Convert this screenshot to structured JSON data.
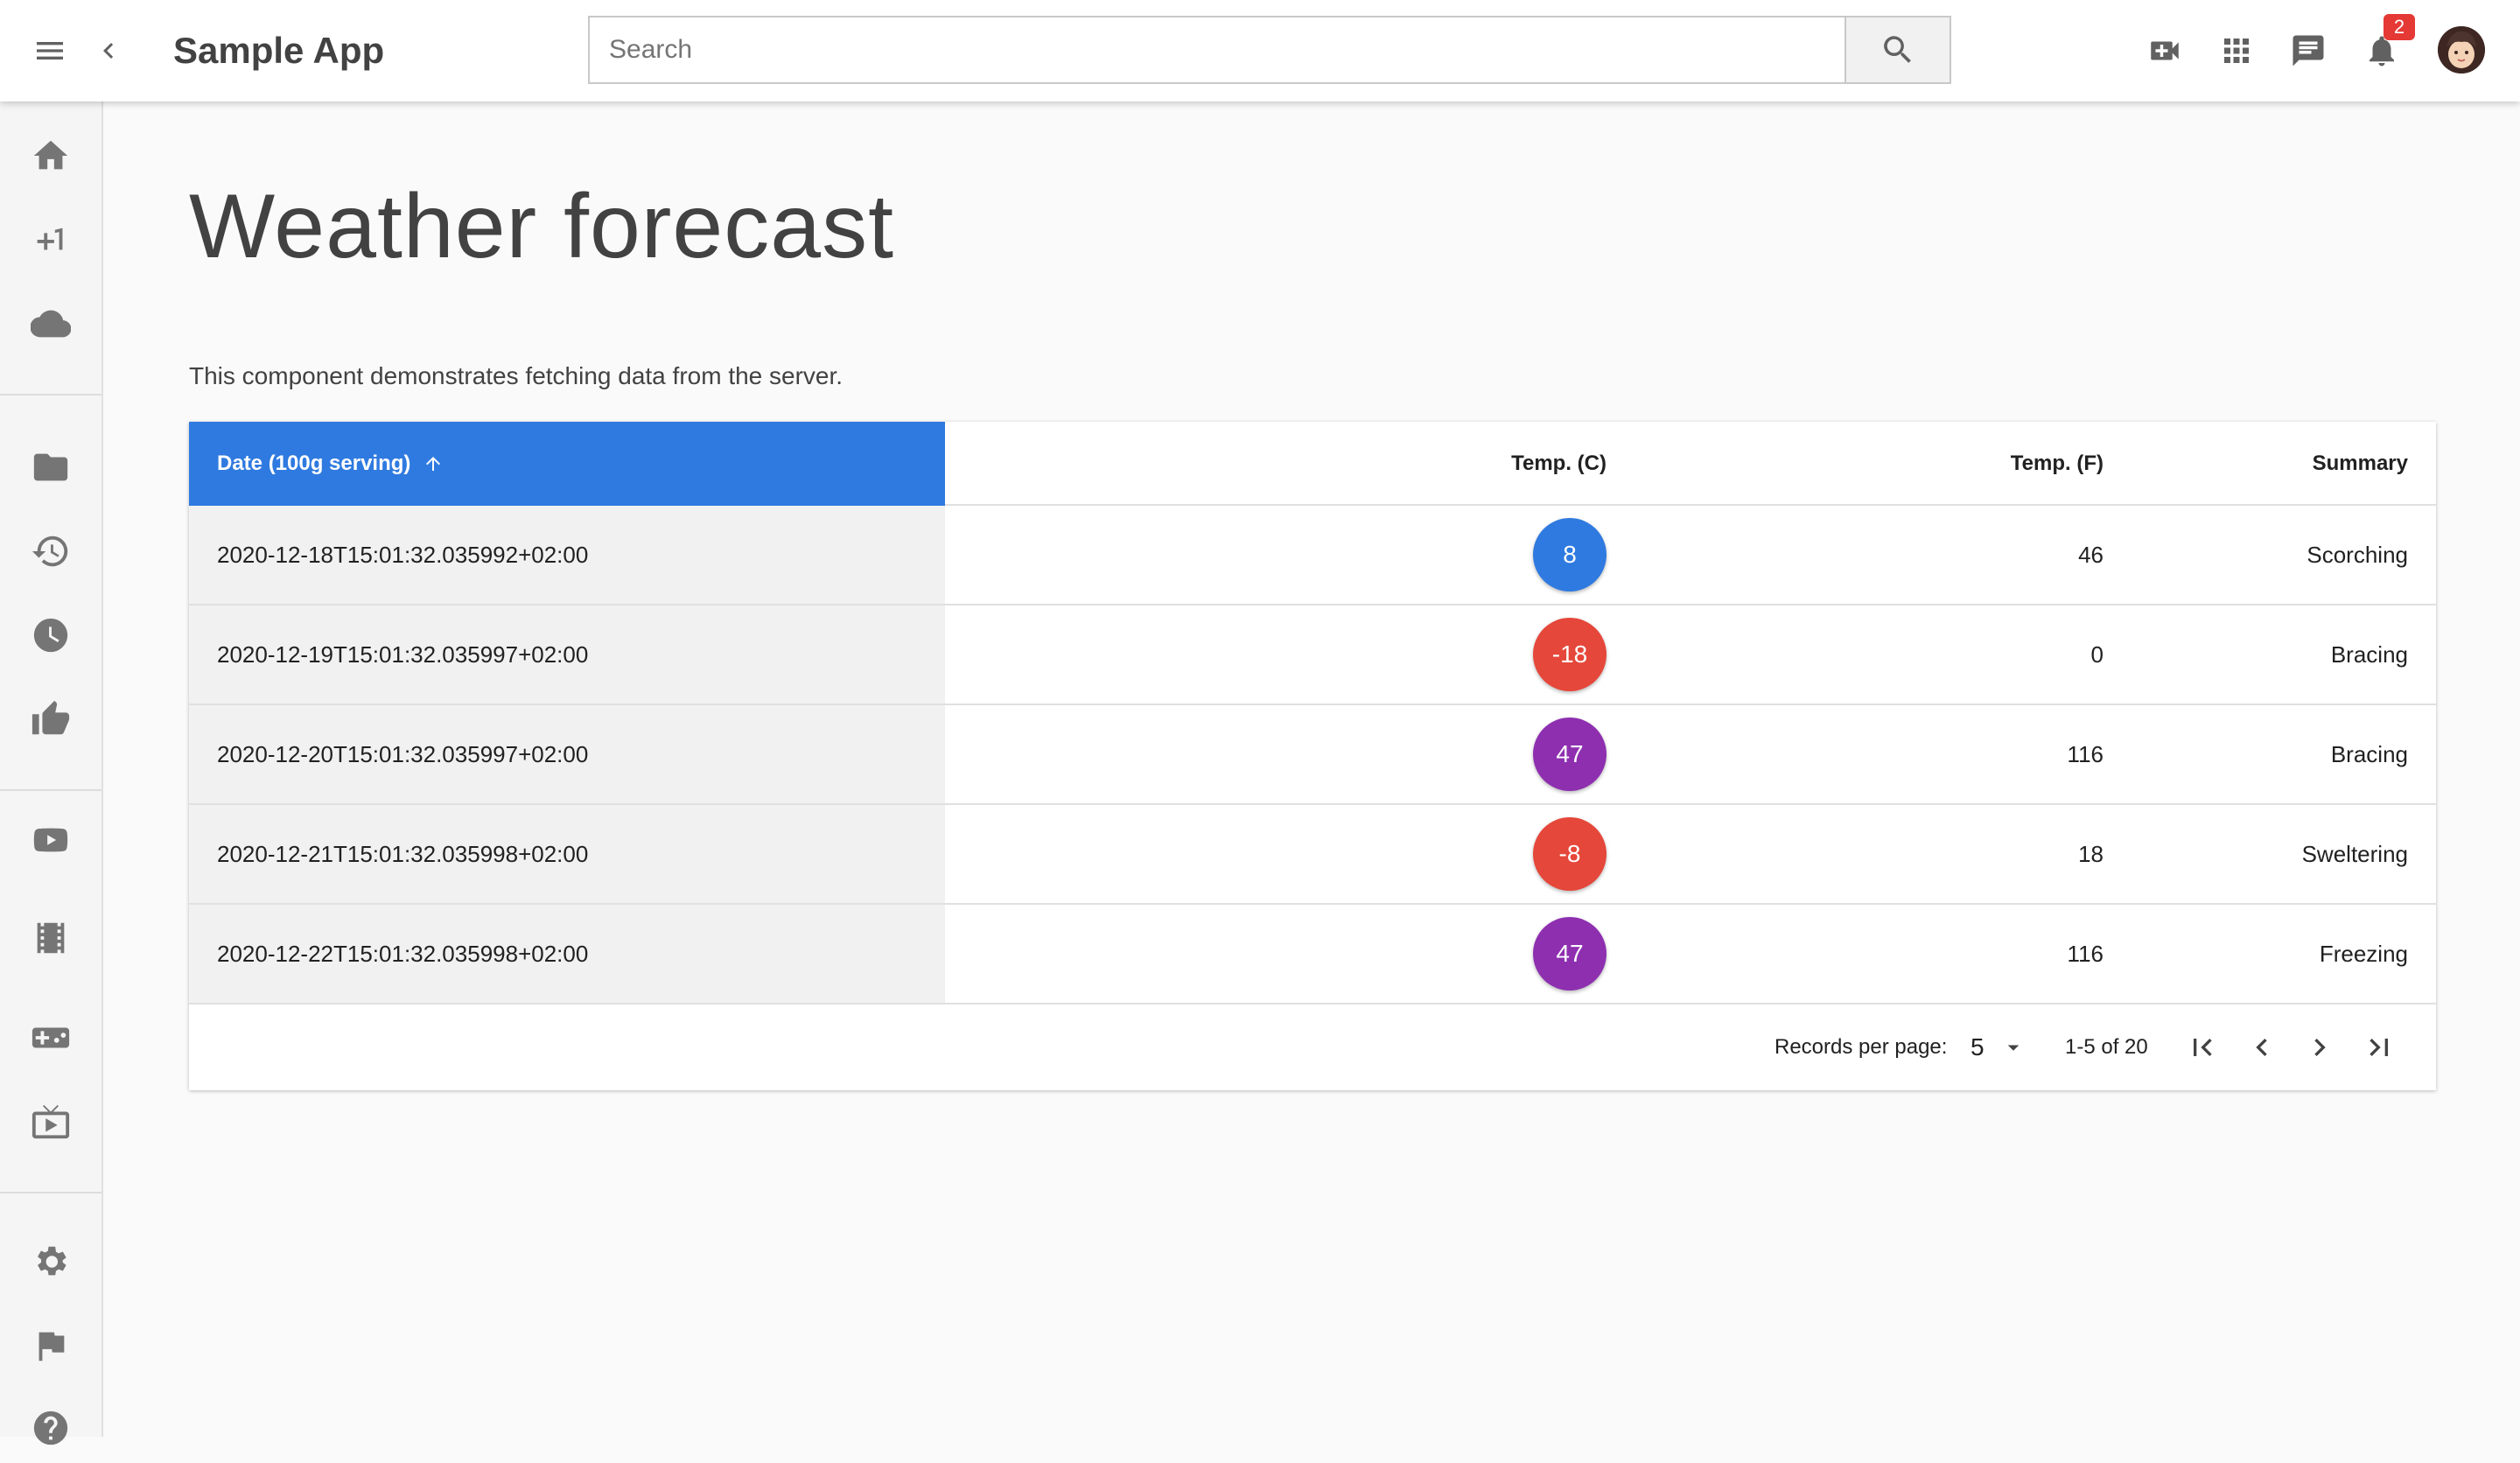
{
  "app": {
    "title": "Sample App"
  },
  "search": {
    "placeholder": "Search",
    "value": ""
  },
  "header": {
    "notification_count": "2",
    "icons": [
      "menu-icon",
      "chevron-left-icon",
      "search-icon",
      "video-call-icon",
      "apps-grid-icon",
      "chat-icon",
      "bell-icon",
      "avatar"
    ]
  },
  "sidebar": {
    "items": [
      {
        "icon": "home-icon"
      },
      {
        "icon": "plus-one-icon"
      },
      {
        "icon": "cloud-icon"
      },
      {
        "icon": "folder-icon"
      },
      {
        "icon": "history-icon"
      },
      {
        "icon": "clock-icon"
      },
      {
        "icon": "thumb-up-icon"
      },
      {
        "icon": "youtube-icon"
      },
      {
        "icon": "movie-icon"
      },
      {
        "icon": "gamepad-icon"
      },
      {
        "icon": "live-tv-icon"
      },
      {
        "icon": "settings-icon"
      },
      {
        "icon": "flag-icon"
      },
      {
        "icon": "help-icon"
      }
    ]
  },
  "page": {
    "title": "Weather forecast",
    "description": "This component demonstrates fetching data from the server."
  },
  "table": {
    "columns": {
      "date": "Date (100g serving)",
      "temp_c": "Temp. (C)",
      "temp_f": "Temp. (F)",
      "summary": "Summary"
    },
    "sorted_column": "date",
    "sort_direction": "ascending",
    "rows": [
      {
        "date": "2020-12-18T15:01:32.035992+02:00",
        "temp_c": "8",
        "temp_f": "46",
        "summary": "Scorching",
        "color": "#2f7ae0"
      },
      {
        "date": "2020-12-19T15:01:32.035997+02:00",
        "temp_c": "-18",
        "temp_f": "0",
        "summary": "Bracing",
        "color": "#e5473a"
      },
      {
        "date": "2020-12-20T15:01:32.035997+02:00",
        "temp_c": "47",
        "temp_f": "116",
        "summary": "Bracing",
        "color": "#8e2fb0"
      },
      {
        "date": "2020-12-21T15:01:32.035998+02:00",
        "temp_c": "-8",
        "temp_f": "18",
        "summary": "Sweltering",
        "color": "#e5473a"
      },
      {
        "date": "2020-12-22T15:01:32.035998+02:00",
        "temp_c": "47",
        "temp_f": "116",
        "summary": "Freezing",
        "color": "#8e2fb0"
      }
    ]
  },
  "pagination": {
    "records_per_page_label": "Records per page:",
    "records_per_page_value": "5",
    "range": "1-5 of 20"
  },
  "colors": {
    "accent": "#2f7ae0",
    "cold": "#2f7ae0",
    "hot": "#8e2fb0",
    "freezing": "#e5473a",
    "badge": "#e53935"
  }
}
